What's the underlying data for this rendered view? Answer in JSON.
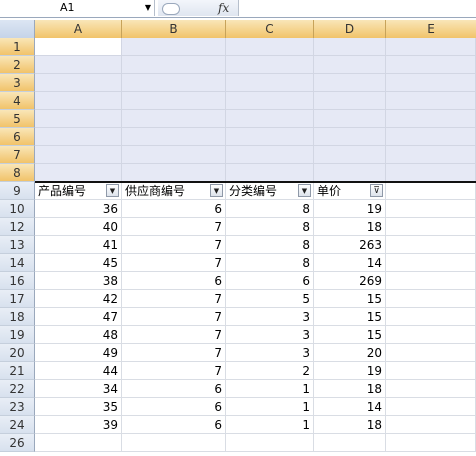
{
  "formula_bar": {
    "name_box": "A1",
    "fx_label": "fx",
    "formula": ""
  },
  "columns": [
    "A",
    "B",
    "C",
    "D",
    "E"
  ],
  "header_row": {
    "row_number": "9",
    "cells": [
      "产品编号",
      "供应商编号",
      "分类编号",
      "单价"
    ],
    "filter_active_column": "D"
  },
  "empty_rows_top": [
    "1",
    "2",
    "3",
    "4",
    "5",
    "6",
    "7",
    "8"
  ],
  "data_rows": [
    {
      "row": "10",
      "values": [
        "36",
        "6",
        "8",
        "19"
      ]
    },
    {
      "row": "12",
      "values": [
        "40",
        "7",
        "8",
        "18"
      ]
    },
    {
      "row": "13",
      "values": [
        "41",
        "7",
        "8",
        "263"
      ]
    },
    {
      "row": "14",
      "values": [
        "45",
        "7",
        "8",
        "14"
      ]
    },
    {
      "row": "16",
      "values": [
        "38",
        "6",
        "6",
        "269"
      ]
    },
    {
      "row": "17",
      "values": [
        "42",
        "7",
        "5",
        "15"
      ]
    },
    {
      "row": "18",
      "values": [
        "47",
        "7",
        "3",
        "15"
      ]
    },
    {
      "row": "19",
      "values": [
        "48",
        "7",
        "3",
        "15"
      ]
    },
    {
      "row": "20",
      "values": [
        "49",
        "7",
        "3",
        "20"
      ]
    },
    {
      "row": "21",
      "values": [
        "44",
        "7",
        "2",
        "19"
      ]
    },
    {
      "row": "22",
      "values": [
        "34",
        "6",
        "1",
        "18"
      ]
    },
    {
      "row": "23",
      "values": [
        "35",
        "6",
        "1",
        "14"
      ]
    },
    {
      "row": "24",
      "values": [
        "39",
        "6",
        "1",
        "18"
      ]
    }
  ],
  "trailing_rows": [
    "26"
  ],
  "colors": {
    "selection": "#e6e9f5",
    "header_highlight": "#f1c36a",
    "grid": "#d9dde4"
  }
}
